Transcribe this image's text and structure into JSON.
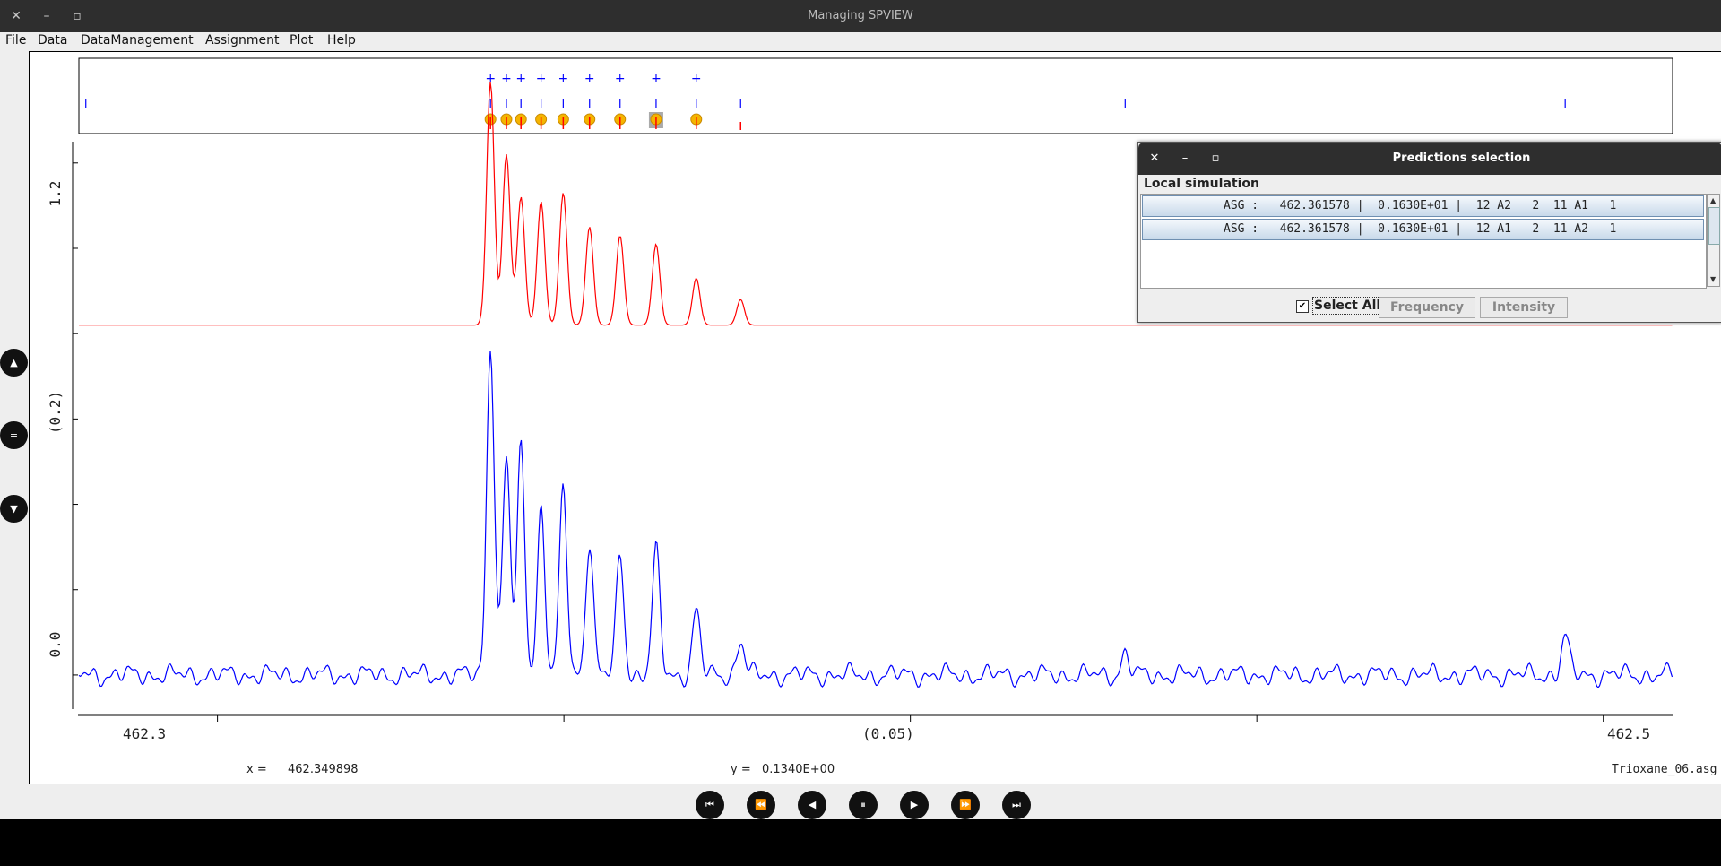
{
  "window": {
    "title": "Managing SPVIEW",
    "controls": [
      "close-icon",
      "minimize-icon",
      "maximize-icon"
    ]
  },
  "menu": {
    "items": [
      "File",
      "Data",
      "DataManagement",
      "Assignment",
      "Plot",
      "Help"
    ]
  },
  "side_buttons": [
    "arrow-up-icon",
    "equals-icon",
    "arrow-down-icon"
  ],
  "plot": {
    "x_ticks": [
      "462.3",
      "(0.05)",
      "462.5"
    ],
    "y_ticks": [
      "1.2",
      "(0.2)",
      "0.0"
    ],
    "xlim": [
      462.28,
      462.51
    ],
    "top_lines": [
      462.281,
      462.3394,
      462.3417,
      462.3438,
      462.3467,
      462.3499,
      462.3537,
      462.3581,
      462.3633,
      462.3691,
      462.3755,
      462.431,
      462.4945
    ],
    "crosses": [
      462.3394,
      462.3417,
      462.3438,
      462.3467,
      462.3499,
      462.3537,
      462.3581,
      462.3633,
      462.3691
    ],
    "markers": [
      462.3394,
      462.3417,
      462.3438,
      462.3467,
      462.3499,
      462.3537,
      462.3581,
      462.3633,
      462.3691
    ],
    "selected_marker": 462.3633
  },
  "chart_data": {
    "type": "line",
    "xlabel": "",
    "ylabel": "",
    "xlim": [
      462.28,
      462.51
    ],
    "ylim": [
      -0.08,
      1.25
    ],
    "y_offsets": {
      "simulation": 0.82,
      "observed": 0.0
    },
    "series": [
      {
        "role": "simulation",
        "color": "#ff0000",
        "peaks": [
          [
            462.3394,
            0.57
          ],
          [
            462.3417,
            0.4
          ],
          [
            462.3438,
            0.3
          ],
          [
            462.3467,
            0.29
          ],
          [
            462.3499,
            0.31
          ],
          [
            462.3537,
            0.23
          ],
          [
            462.3581,
            0.21
          ],
          [
            462.3633,
            0.19
          ],
          [
            462.3691,
            0.11
          ],
          [
            462.3755,
            0.06
          ]
        ]
      },
      {
        "role": "observed",
        "color": "#0000ff",
        "peaks": [
          [
            462.3394,
            0.78
          ],
          [
            462.3417,
            0.51
          ],
          [
            462.3438,
            0.53
          ],
          [
            462.3467,
            0.39
          ],
          [
            462.3499,
            0.43
          ],
          [
            462.3537,
            0.32
          ],
          [
            462.3581,
            0.28
          ],
          [
            462.3633,
            0.29
          ],
          [
            462.3691,
            0.15
          ],
          [
            462.3755,
            0.08
          ],
          [
            462.431,
            0.05
          ],
          [
            462.4945,
            0.09
          ]
        ]
      }
    ]
  },
  "status": {
    "x_label": "x =",
    "x_value": "462.349898",
    "y_label": "y =",
    "y_value": "0.1340E+00",
    "file": "Trioxane_06.asg"
  },
  "player_buttons": [
    "skip-first-icon",
    "fast-rewind-icon",
    "step-back-icon",
    "pause-icon",
    "play-icon",
    "fast-forward-icon",
    "skip-last-icon"
  ],
  "dialog": {
    "title": "Predictions selection",
    "subtitle": "Local simulation",
    "rows": [
      "ASG :   462.361578 |  0.1630E+01 |  12 A2   2  11 A1   1",
      "ASG :   462.361578 |  0.1630E+01 |  12 A1   2  11 A2   1"
    ],
    "select_all_label": "Select All",
    "select_all_checked": true,
    "frequency_label": "Frequency",
    "intensity_label": "Intensity"
  },
  "colors": {
    "simulation": "#ff0000",
    "observed": "#0000ff",
    "marker": "#f5b400",
    "titlebar": "#2e2e2e"
  }
}
